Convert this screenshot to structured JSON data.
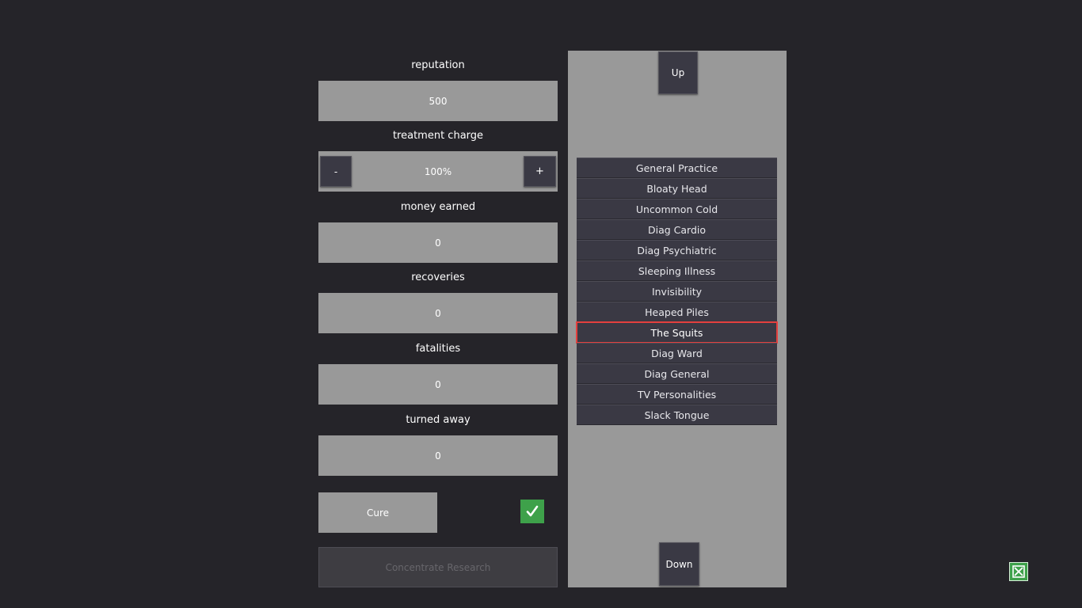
{
  "stats": {
    "reputation_label": "reputation",
    "reputation_value": "500",
    "treatment_charge_label": "treatment charge",
    "treatment_charge_value": "100%",
    "decrease_label": "-",
    "increase_label": "+",
    "money_earned_label": "money earned",
    "money_earned_value": "0",
    "recoveries_label": "recoveries",
    "recoveries_value": "0",
    "fatalities_label": "fatalities",
    "fatalities_value": "0",
    "turned_away_label": "turned away",
    "turned_away_value": "0"
  },
  "cure": {
    "label": "Cure",
    "checked": true,
    "check_icon": "checkmark-icon"
  },
  "concentrate_research_label": "Concentrate Research",
  "scroll": {
    "up_label": "Up",
    "down_label": "Down"
  },
  "list": {
    "selected_index": 8,
    "items": [
      {
        "label": "General Practice"
      },
      {
        "label": "Bloaty Head"
      },
      {
        "label": "Uncommon Cold"
      },
      {
        "label": "Diag Cardio"
      },
      {
        "label": "Diag Psychiatric"
      },
      {
        "label": "Sleeping Illness"
      },
      {
        "label": "Invisibility"
      },
      {
        "label": "Heaped Piles"
      },
      {
        "label": "The Squits"
      },
      {
        "label": "Diag Ward"
      },
      {
        "label": "Diag General"
      },
      {
        "label": "TV Personalities"
      },
      {
        "label": "Slack Tongue"
      }
    ]
  },
  "close_icon": "close-icon",
  "colors": {
    "background": "#252429",
    "panel": "#999999",
    "button": "#3a3944",
    "accent_green": "#3ea14a",
    "selection_red": "#e3403e"
  }
}
